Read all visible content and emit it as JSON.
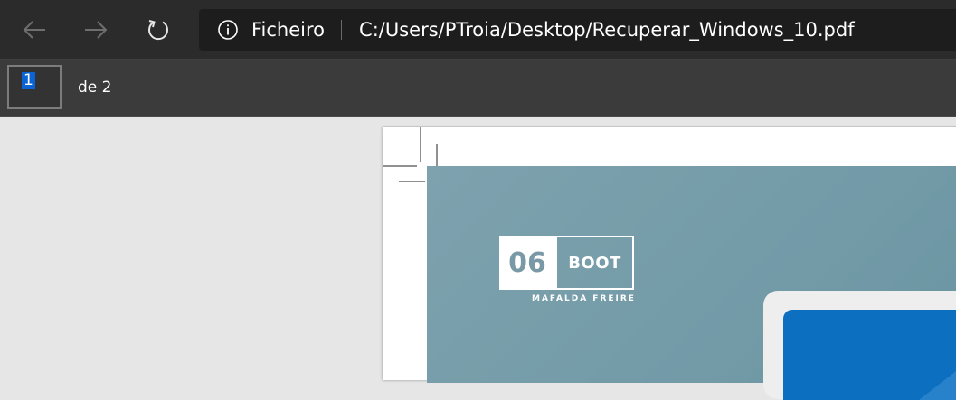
{
  "titlebar": {
    "back_icon": "arrow-left-icon",
    "forward_icon": "arrow-right-icon",
    "refresh_icon": "refresh-icon"
  },
  "address": {
    "info_icon": "info-icon",
    "site_label": "Ficheiro",
    "url": "C:/Users/PTroia/Desktop/Recuperar_Windows_10.pdf"
  },
  "pager": {
    "current_page": "1",
    "total_label": "de 2"
  },
  "document": {
    "logo_number": "06",
    "logo_word": "BOOT",
    "author": "MAFALDA FREIRE"
  },
  "colors": {
    "titlebar_bg": "#2b2b2b",
    "toolbar_bg": "#3b3b3b",
    "page_selection": "#0a64d6",
    "content_bg": "#7a9da9",
    "screen_blue": "#0c6fc0"
  }
}
